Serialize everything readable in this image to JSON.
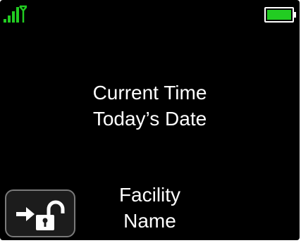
{
  "status_bar": {
    "signal_icon": "signal-strength-antenna-icon",
    "battery_icon": "battery-full-icon",
    "signal_color": "#22cc22",
    "battery_color": "#22cc22"
  },
  "main": {
    "time_label": "Current Time",
    "date_label": "Today’s Date"
  },
  "facility": {
    "line1": "Facility",
    "line2": "Name"
  },
  "unlock_button": {
    "icon": "arrow-unlock-padlock-icon"
  },
  "colors": {
    "background": "#000000",
    "text": "#ffffff",
    "accent_green": "#22cc22"
  }
}
